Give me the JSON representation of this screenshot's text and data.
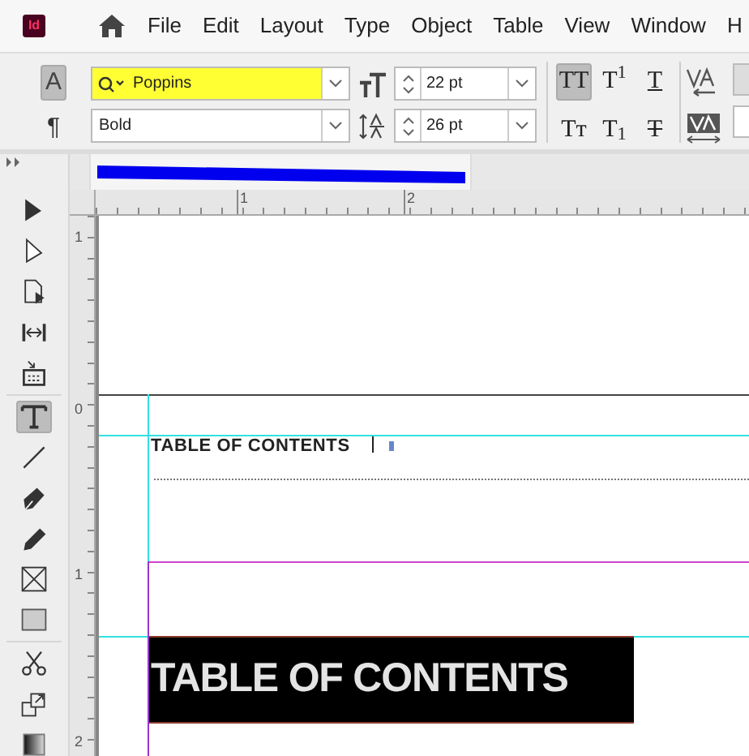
{
  "app_logo": "Id",
  "menu": [
    "File",
    "Edit",
    "Layout",
    "Type",
    "Object",
    "Table",
    "View",
    "Window",
    "H"
  ],
  "control_panel": {
    "modes": [
      {
        "label": "A",
        "selected": true
      },
      {
        "label": "¶",
        "selected": false
      }
    ],
    "font_family": "Poppins",
    "font_family_highlighted": true,
    "font_style": "Bold",
    "font_size": "22 pt",
    "leading": "26 pt",
    "type_buttons": [
      {
        "kind": "all_caps",
        "label": "TT",
        "selected": true
      },
      {
        "kind": "superscript",
        "label": "T$^{1}$",
        "selected": false
      },
      {
        "kind": "underline",
        "label": "T",
        "selected": false
      },
      {
        "kind": "small_caps",
        "label": "Tᴛ",
        "selected": false
      },
      {
        "kind": "subscript",
        "label": "T$_{1}$",
        "selected": false
      },
      {
        "kind": "strikethrough",
        "label": "T",
        "selected": false
      }
    ]
  },
  "tools": [
    {
      "kind": "selection",
      "selected": false
    },
    {
      "kind": "direct_selection",
      "selected": false
    },
    {
      "kind": "page",
      "selected": false
    },
    {
      "kind": "gap",
      "selected": false
    },
    {
      "kind": "content_collector",
      "selected": false
    },
    {
      "kind": "type",
      "selected": true
    },
    {
      "kind": "line",
      "selected": false
    },
    {
      "kind": "pen",
      "selected": false
    },
    {
      "kind": "pencil",
      "selected": false
    },
    {
      "kind": "frame",
      "selected": false
    },
    {
      "kind": "rectangle",
      "selected": false
    },
    {
      "kind": "scissors",
      "selected": false
    },
    {
      "kind": "transform",
      "selected": false
    },
    {
      "kind": "gradient",
      "selected": false
    }
  ],
  "document_tab": {
    "title_redacted": true
  },
  "horizontal_ruler": [
    "1",
    "2"
  ],
  "vertical_ruler": [
    "1",
    "0",
    "1",
    "2"
  ],
  "page": {
    "toc_heading": "TABLE OF CONTENTS",
    "banner_heading": "TABLE OF CONTENTS"
  }
}
